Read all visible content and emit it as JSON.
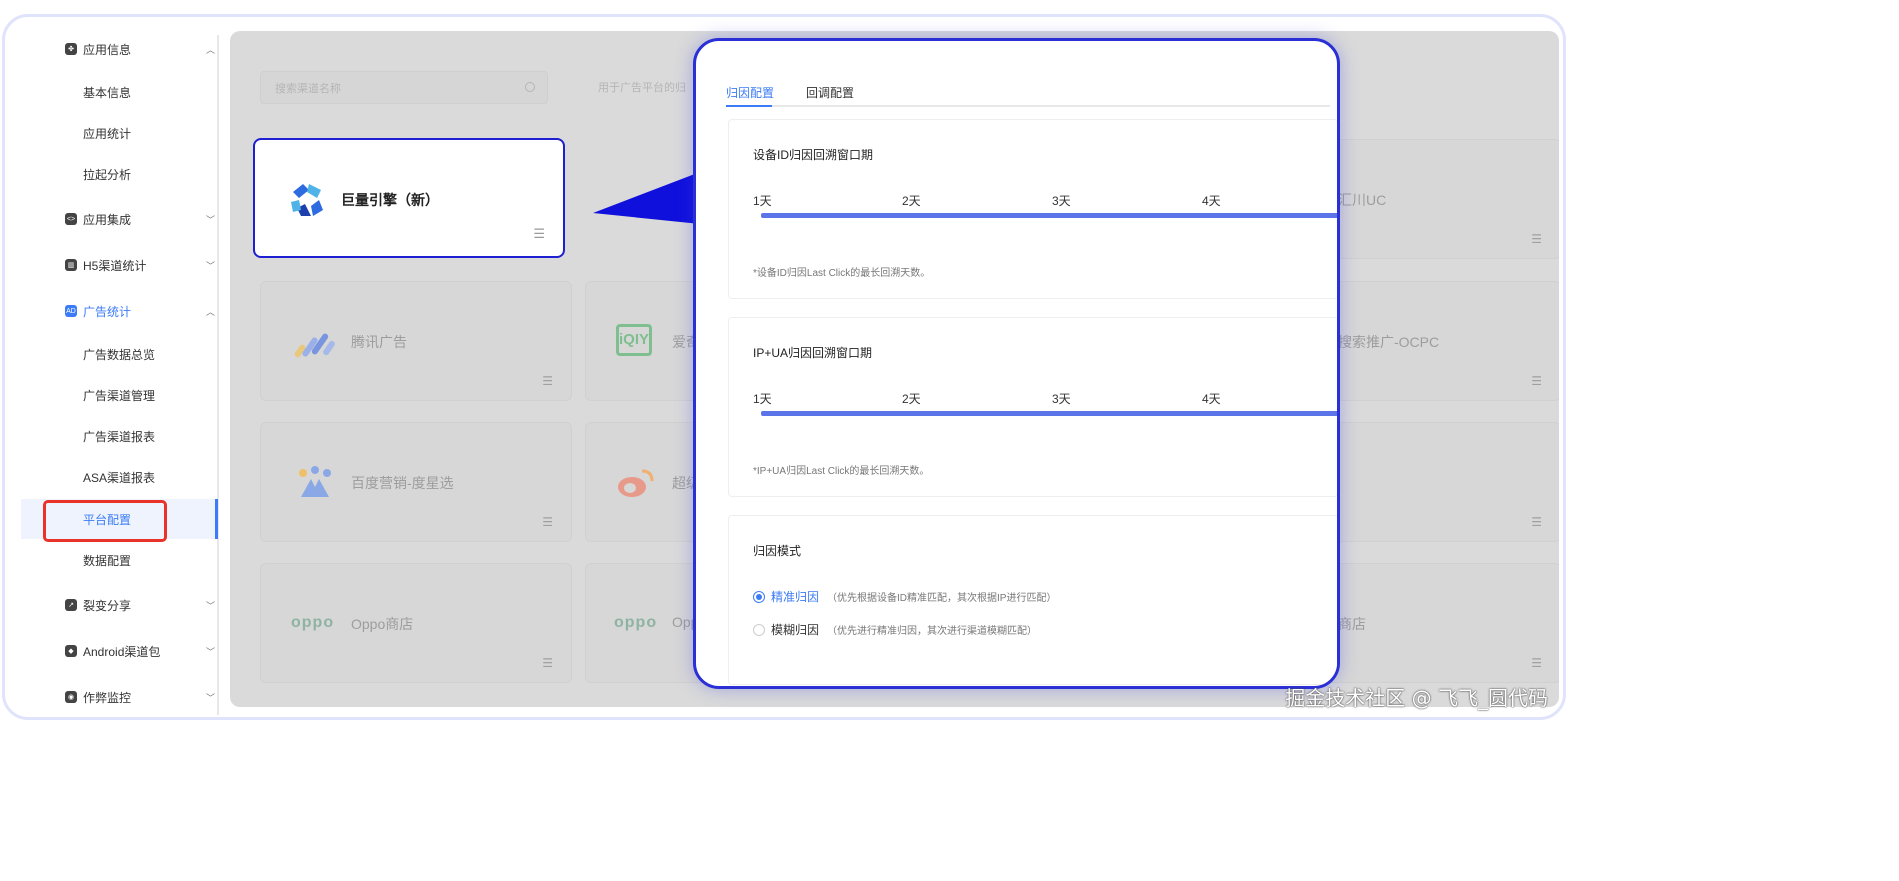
{
  "sidebar": {
    "groups": [
      {
        "label": "应用信息",
        "icon": "apps-icon",
        "expanded": true
      },
      {
        "label": "应用集成",
        "icon": "code-icon",
        "expanded": false
      },
      {
        "label": "H5渠道统计",
        "icon": "chart-icon",
        "expanded": false
      },
      {
        "label": "广告统计",
        "icon": "ad-icon",
        "expanded": true,
        "active": true
      },
      {
        "label": "裂变分享",
        "icon": "share-icon",
        "expanded": false
      },
      {
        "label": "Android渠道包",
        "icon": "android-icon",
        "expanded": false
      },
      {
        "label": "作弊监控",
        "icon": "shield-icon",
        "expanded": false
      }
    ],
    "app_info_items": [
      "基本信息",
      "应用统计",
      "拉起分析"
    ],
    "ad_items": [
      "广告数据总览",
      "广告渠道管理",
      "广告渠道报表",
      "ASA渠道报表",
      "平台配置",
      "数据配置"
    ],
    "selected_item": "平台配置"
  },
  "main": {
    "search_placeholder": "搜索渠道名称",
    "hint": "用于广告平台的归",
    "highlighted_card": {
      "name": "巨量引擎（新）"
    },
    "cards": [
      {
        "name": "汇川UC"
      },
      {
        "name": "腾讯广告"
      },
      {
        "name": "爱奇"
      },
      {
        "name": "搜索推广-OCPC"
      },
      {
        "name": "百度营销-度星选"
      },
      {
        "name": "超级"
      },
      {
        "name": "Oppo商店",
        "logo_text": "oppo"
      },
      {
        "name": "Opp",
        "logo_text": "oppo"
      },
      {
        "name": "商店"
      }
    ]
  },
  "popup": {
    "tabs": [
      "归因配置",
      "回调配置"
    ],
    "active_tab": "归因配置",
    "device_panel": {
      "title": "设备ID归因回溯窗口期",
      "days": [
        "1天",
        "2天",
        "3天",
        "4天"
      ],
      "note": "*设备ID归因Last Click的最长回溯天数。"
    },
    "ipua_panel": {
      "title": "IP+UA归因回溯窗口期",
      "days": [
        "1天",
        "2天",
        "3天",
        "4天"
      ],
      "note": "*IP+UA归因Last Click的最长回溯天数。"
    },
    "mode_panel": {
      "title": "归因模式",
      "options": [
        {
          "label": "精准归因",
          "desc": "（优先根据设备ID精准匹配，其次根据IP进行匹配）",
          "selected": true
        },
        {
          "label": "模糊归因",
          "desc": "（优先进行精准归因，其次进行渠道模糊匹配）",
          "selected": false
        }
      ]
    }
  },
  "watermark": "掘金技术社区 @ 飞飞_圆代码",
  "colors": {
    "accent": "#3b7cf6",
    "highlight_border": "#1d1fd0",
    "red_box": "#e8322a",
    "slider": "#5b74e8"
  }
}
